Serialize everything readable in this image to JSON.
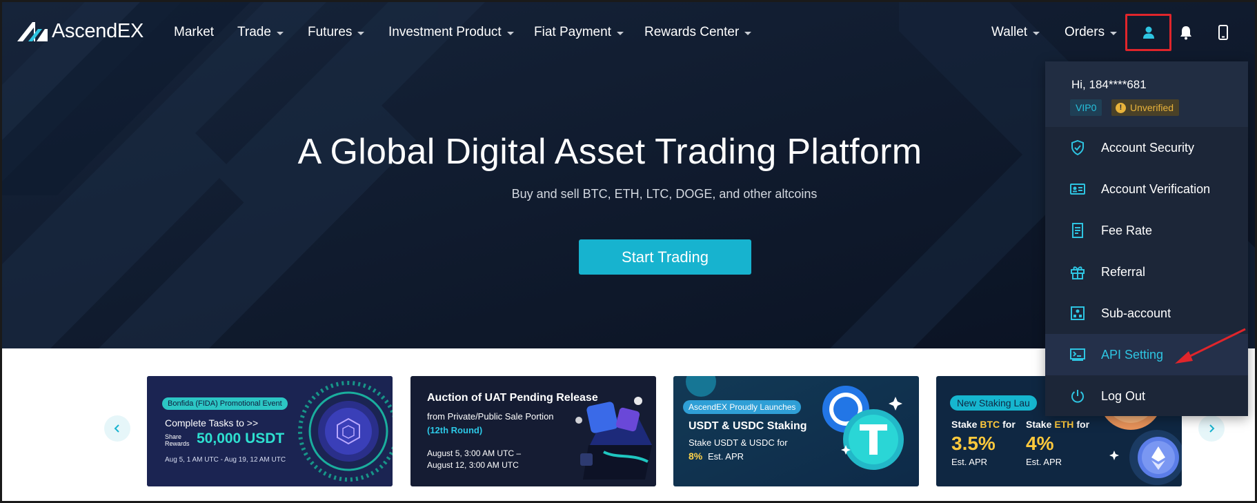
{
  "header": {
    "logo_text": "AscendEX",
    "nav": [
      {
        "label": "Market"
      },
      {
        "label": "Trade"
      },
      {
        "label": "Futures"
      },
      {
        "label": "Investment Product"
      },
      {
        "label": "Fiat Payment"
      },
      {
        "label": "Rewards Center"
      }
    ],
    "right_nav": [
      {
        "label": "Wallet"
      },
      {
        "label": "Orders"
      }
    ],
    "icons": [
      "user-icon",
      "bell-icon",
      "phone-icon"
    ]
  },
  "hero": {
    "title": "A Global Digital Asset Trading Platform",
    "subtitle": "Buy and sell BTC, ETH, LTC, DOGE, and other altcoins",
    "cta_label": "Start Trading"
  },
  "banners": [
    {
      "tag": "Bonfida (FIDA) Promotional Event",
      "line1": "Complete Tasks to >>",
      "share": "Share",
      "rewards": "Rewards",
      "amount": "50,000 USDT",
      "date": "Aug 5, 1 AM UTC - Aug 19, 12 AM UTC"
    },
    {
      "title": "Auction of UAT Pending Release",
      "line1": "from Private/Public Sale Portion",
      "round": "(12th Round)",
      "date1": "August 5, 3:00 AM UTC –",
      "date2": "August 12, 3:00 AM UTC"
    },
    {
      "tag": "AscendEX Proudly Launches",
      "title": "USDT & USDC Staking",
      "line1": "Stake USDT & USDC for",
      "rate": "8%",
      "rate_suffix": "Est. APR"
    },
    {
      "tag": "New Staking Lau",
      "stake_btc_prefix": "Stake",
      "stake_btc_coin": "BTC",
      "stake_btc_suffix": "for",
      "btc_rate": "3.5%",
      "stake_eth_prefix": "Stake",
      "stake_eth_coin": "ETH",
      "stake_eth_suffix": "for",
      "eth_rate": "4%",
      "apr": "Est. APR"
    }
  ],
  "account_menu": {
    "greeting": "Hi, 184****681",
    "vip": "VIP0",
    "status": "Unverified",
    "status_icon": "!",
    "items": [
      {
        "label": "Account Security",
        "icon": "shield-icon"
      },
      {
        "label": "Account Verification",
        "icon": "id-card-icon"
      },
      {
        "label": "Fee Rate",
        "icon": "receipt-icon"
      },
      {
        "label": "Referral",
        "icon": "gift-icon"
      },
      {
        "label": "Sub-account",
        "icon": "sub-account-icon"
      },
      {
        "label": "API Setting",
        "icon": "api-icon",
        "active": true
      },
      {
        "label": "Log Out",
        "icon": "power-icon"
      }
    ]
  },
  "colors": {
    "accent": "#17b3cf",
    "menu_bg": "#1c2638",
    "highlight_border": "#e0252b",
    "hero_bg": "#0c1526"
  }
}
